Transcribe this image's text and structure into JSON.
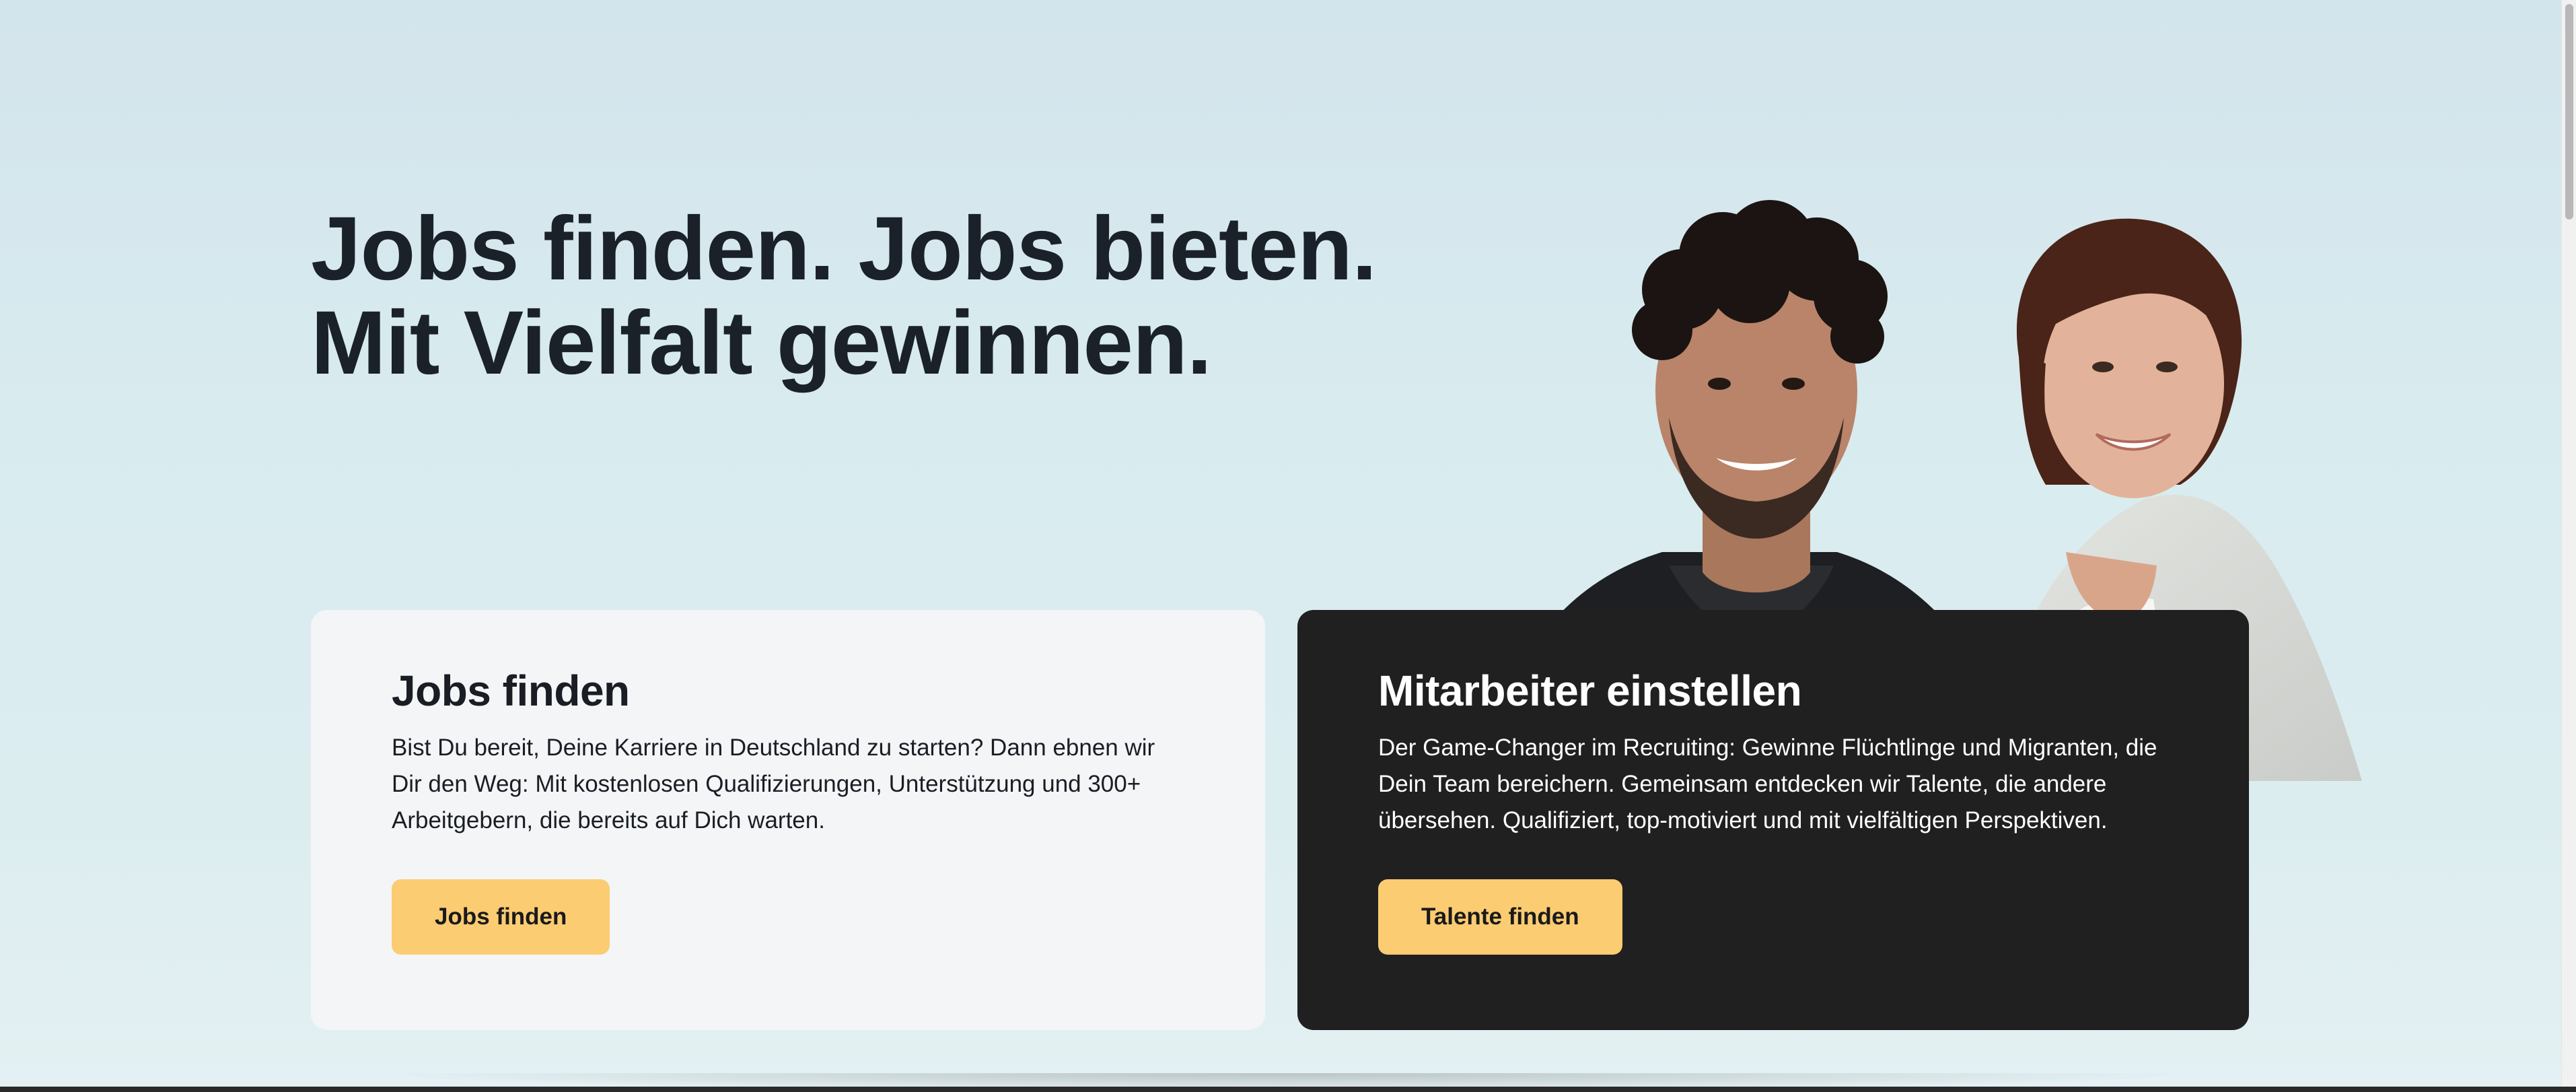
{
  "hero": {
    "headline_line1": "Jobs finden. Jobs bieten.",
    "headline_line2": "Mit Vielfalt gewinnen."
  },
  "cards": [
    {
      "title": "Jobs finden",
      "text": "Bist Du bereit, Deine Karriere in Deutschland zu starten? Dann ebnen wir Dir den Weg: Mit kostenlosen Qualifizierungen, Unterstützung und 300+ Arbeitgebern, die bereits auf Dich warten.",
      "button_label": "Jobs finden"
    },
    {
      "title": "Mitarbeiter einstellen",
      "text": "Der Game-Changer im Recruiting: Gewinne Flüchtlinge und Migranten, die Dein Team bereichern. Gemeinsam entdecken wir Talente, die andere übersehen. Qualifiziert, top-motiviert und mit vielfältigen Perspektiven.",
      "button_label": "Talente finden"
    }
  ],
  "colors": {
    "accent_button": "#fccc72",
    "dark_card": "#202020",
    "light_card": "#f3f5f7",
    "headline": "#1a2129"
  }
}
